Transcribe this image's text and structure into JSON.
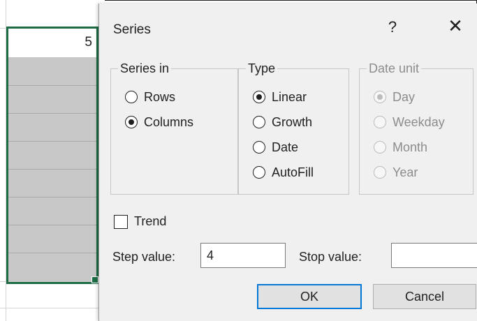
{
  "spreadsheet": {
    "cell_value": "5"
  },
  "dialog": {
    "title": "Series",
    "help_label": "?",
    "close_label": "✕",
    "series_in": {
      "label": "Series in",
      "options": [
        {
          "label": "Rows",
          "checked": false
        },
        {
          "label": "Columns",
          "checked": true
        }
      ]
    },
    "type": {
      "label": "Type",
      "options": [
        {
          "label": "Linear",
          "checked": true
        },
        {
          "label": "Growth",
          "checked": false
        },
        {
          "label": "Date",
          "checked": false
        },
        {
          "label": "AutoFill",
          "checked": false
        }
      ]
    },
    "date_unit": {
      "label": "Date unit",
      "disabled": true,
      "options": [
        {
          "label": "Day",
          "checked": true
        },
        {
          "label": "Weekday",
          "checked": false
        },
        {
          "label": "Month",
          "checked": false
        },
        {
          "label": "Year",
          "checked": false
        }
      ]
    },
    "trend": {
      "label": "Trend",
      "checked": false
    },
    "step_value": {
      "label": "Step value:",
      "value": "4"
    },
    "stop_value": {
      "label": "Stop value:",
      "value": ""
    },
    "ok_label": "OK",
    "cancel_label": "Cancel"
  },
  "colors": {
    "selection_border": "#1e6b45",
    "default_button_border": "#0078d7",
    "selected_fill": "#c8c8c8"
  }
}
